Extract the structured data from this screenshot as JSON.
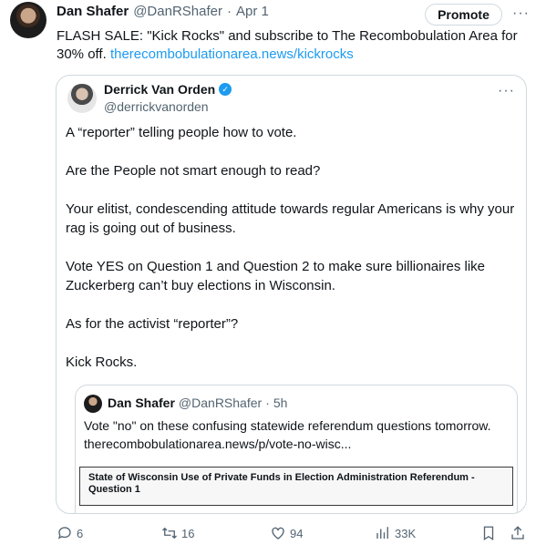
{
  "tweet": {
    "author_name": "Dan Shafer",
    "author_handle": "@DanRShafer",
    "separator": "·",
    "date": "Apr 1",
    "promote_label": "Promote",
    "more_label": "···",
    "text": "FLASH SALE: \"Kick Rocks\" and subscribe to The Recombobulation Area for 30% off.",
    "link": "therecombobulationarea.news/kickrocks"
  },
  "quote": {
    "author_name": "Derrick Van Orden",
    "verified_label": "✓",
    "author_handle": "@derrickvanorden",
    "more_label": "···",
    "paragraphs": [
      "A “reporter” telling people how to vote.",
      "Are the People not smart enough to read?",
      "Your elitist, condescending attitude towards regular Americans is why your rag is going out of business.",
      "Vote YES on Question 1 and Question 2 to make sure billionaires like Zuckerberg can’t buy elections in Wisconsin.",
      "As for the activist “reporter”?",
      "Kick Rocks."
    ]
  },
  "inner_quote": {
    "author_name": "Dan Shafer",
    "author_handle": "@DanRShafer",
    "separator": "·",
    "time": "5h",
    "text_line1": "Vote \"no\" on these confusing statewide referendum questions tomorrow.",
    "text_line2": "therecombobulationarea.news/p/vote-no-wisc...",
    "doc_title": "State of Wisconsin Use of Private Funds in Election Administration Referendum - Question 1"
  },
  "actions": {
    "replies": "6",
    "reposts": "16",
    "likes": "94",
    "views": "33K",
    "icons": [
      "reply-icon",
      "repost-icon",
      "like-icon",
      "views-icon",
      "bookmark-icon",
      "share-icon"
    ]
  }
}
